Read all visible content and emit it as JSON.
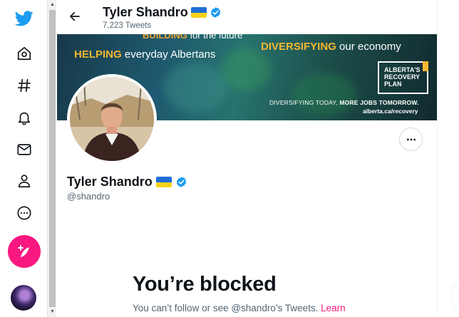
{
  "nav": {
    "items": [
      {
        "name": "twitter-logo-icon"
      },
      {
        "name": "home-icon"
      },
      {
        "name": "explore-hashtag-icon"
      },
      {
        "name": "notifications-bell-icon"
      },
      {
        "name": "messages-envelope-icon"
      },
      {
        "name": "profile-person-icon"
      },
      {
        "name": "more-circle-icon"
      }
    ],
    "compose_icon": "feather-plus-icon"
  },
  "header": {
    "name": "Tyler Shandro",
    "tweet_count": "7,223 Tweets"
  },
  "banner": {
    "top_cut_bold": "BUILDING",
    "top_cut_rest": "for the future",
    "helping_bold": "HELPING",
    "helping_rest": "everyday Albertans",
    "diversifying_bold": "DIVERSIFYING",
    "diversifying_rest": "our economy",
    "plan_line1": "ALBERTA'S",
    "plan_line2": "RECOVERY",
    "plan_line3": "PLAN",
    "tagline_regular": "DIVERSIFYING TODAY,",
    "tagline_bold": "MORE JOBS TOMORROW.",
    "url": "alberta.ca/recovery"
  },
  "profile": {
    "name": "Tyler Shandro",
    "handle": "@shandro"
  },
  "blocked": {
    "title": "You’re blocked",
    "description": "You can’t follow or see @shandro’s Tweets.",
    "link": "Learn"
  },
  "colors": {
    "twitter_blue": "#1d9bf0",
    "compose_pink": "#f91880",
    "flag_blue": "#1f6ed6",
    "flag_yellow": "#f7d21b",
    "banner_orange": "#f5b730"
  }
}
